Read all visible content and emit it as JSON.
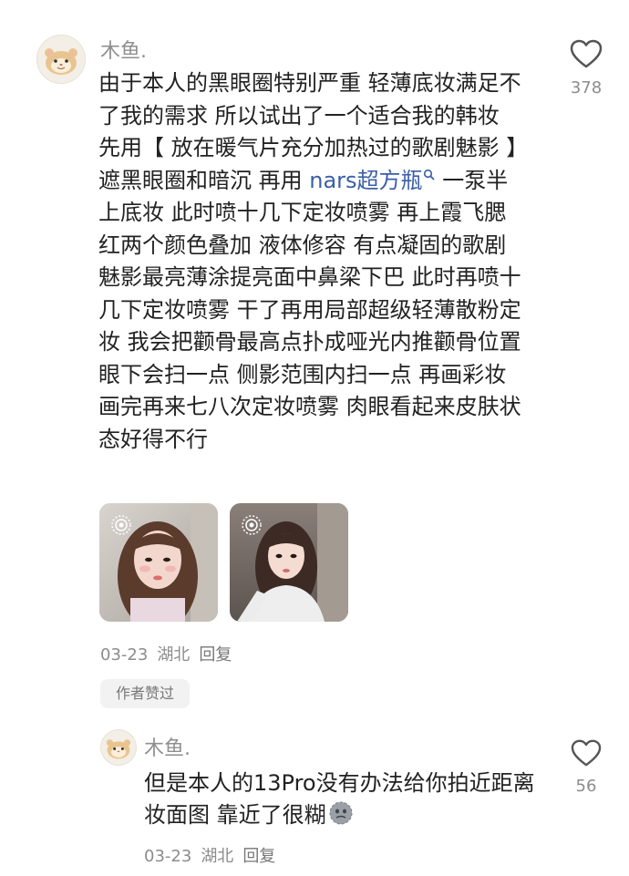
{
  "comment": {
    "username": "木鱼.",
    "likes": "378",
    "text_before_link": "由于本人的黑眼圈特别严重 轻薄底妆满足不了我的需求 所以试出了一个适合我的韩妆 先用【 放在暖气片充分加热过的歌剧魅影 】遮黑眼圈和暗沉 再用 ",
    "link_text": "nars超方瓶",
    "text_after_link": " 一泵半上底妆 此时喷十几下定妆喷雾 再上霞飞腮红两个颜色叠加 液体修容 有点凝固的歌剧魅影最亮薄涂提亮面中鼻梁下巴 此时再喷十几下定妆喷雾 干了再用局部超级轻薄散粉定妆 我会把颧骨最高点扑成哑光内推颧骨位置 眼下会扫一点 侧影范围内扫一点 再画彩妆 画完再来七八次定妆喷雾 肉眼看起来皮肤状态好得不行",
    "date": "03-23",
    "location": "湖北",
    "reply_label": "回复",
    "author_liked_badge": "作者赞过"
  },
  "reply": {
    "username": "木鱼.",
    "likes": "56",
    "text": "但是本人的13Pro没有办法给你拍近距离妆面图 靠近了很糊",
    "date": "03-23",
    "location": "湖北",
    "reply_label": "回复"
  },
  "colors": {
    "link": "#3b5ea8",
    "meta_gray": "#8c8c8c",
    "badge_bg": "#f2f2f2"
  }
}
